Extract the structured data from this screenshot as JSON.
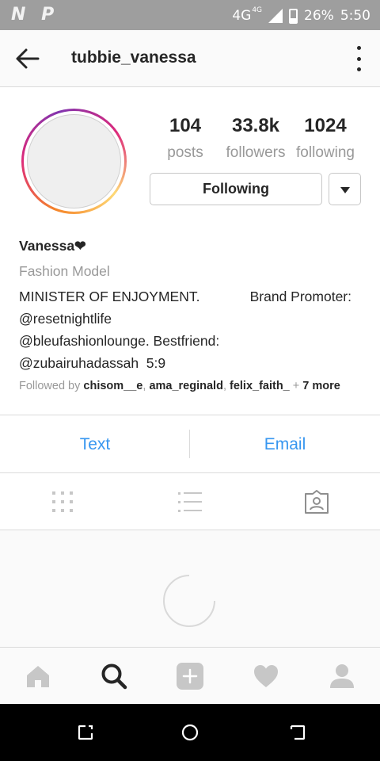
{
  "status_bar": {
    "left_icons": "N P",
    "network": "4G",
    "network_sup": "4G",
    "battery": "26%",
    "time": "5:50"
  },
  "header": {
    "username": "tubbie_vanessa",
    "back_icon": "arrow-left-icon",
    "more_icon": "more-vertical-icon"
  },
  "profile": {
    "stats": {
      "posts": {
        "value": "104",
        "label": "posts"
      },
      "followers": {
        "value": "33.8k",
        "label": "followers"
      },
      "following": {
        "value": "1024",
        "label": "following"
      }
    },
    "following_button": "Following",
    "dropdown_icon": "caret-down-icon"
  },
  "bio": {
    "name": "Vanessa❤",
    "category": "Fashion Model",
    "line1_left": "MINISTER OF ENJOYMENT.",
    "line1_right": "Brand Promoter:",
    "line2": "@resetnightlife",
    "line3": "@bleufashionlounge. Bestfriend:",
    "line4": "@zubairuhadassah  5:9",
    "followed_by_prefix": "Followed by ",
    "followed_by_users": [
      "chisom__e",
      "ama_reginald",
      "felix_faith_"
    ],
    "followed_by_more": "7 more"
  },
  "contact": {
    "text_label": "Text",
    "email_label": "Email",
    "accent_color": "#3897f0"
  },
  "tabs": [
    "grid-icon",
    "list-icon",
    "tagged-icon"
  ],
  "bottom_nav": [
    "home-icon",
    "search-icon",
    "add-icon",
    "heart-icon",
    "profile-icon"
  ],
  "system_nav": [
    "recent-apps-icon",
    "home-circle-icon",
    "back-icon"
  ]
}
